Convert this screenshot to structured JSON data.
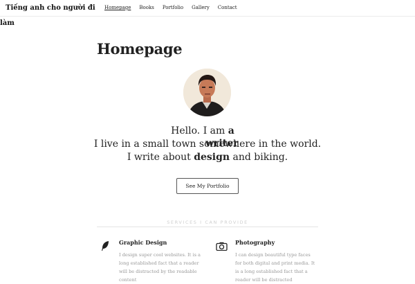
{
  "site": {
    "title_line1": "Tiếng anh cho người đi",
    "title_line2": "làm"
  },
  "nav": {
    "items": [
      {
        "label": "Homepage",
        "active": true
      },
      {
        "label": "Books",
        "active": false
      },
      {
        "label": "Portfolio",
        "active": false
      },
      {
        "label": "Gallery",
        "active": false
      },
      {
        "label": "Contact",
        "active": false
      }
    ]
  },
  "page": {
    "title": "Homepage"
  },
  "intro": {
    "hello": "Hello. I am ",
    "role_a": "a",
    "line2": "I live in a small town somewhere in the world.",
    "role_b": "writer",
    "line3_pre": "I write about ",
    "topic": "design",
    "line3_post": " and biking."
  },
  "cta": {
    "label": "See My Portfolio"
  },
  "services": {
    "heading": "SERVICES I CAN PROVIDE",
    "items": [
      {
        "icon": "feather-icon",
        "title": "Graphic Design",
        "desc": "I design super cool websites. It is a long established fact that a reader will be distracted by the readable content"
      },
      {
        "icon": "camera-icon",
        "title": "Photography",
        "desc": "I can design beautiful type faces for both digital and print media. It is a long established fact that a reader will be distracted"
      }
    ]
  }
}
